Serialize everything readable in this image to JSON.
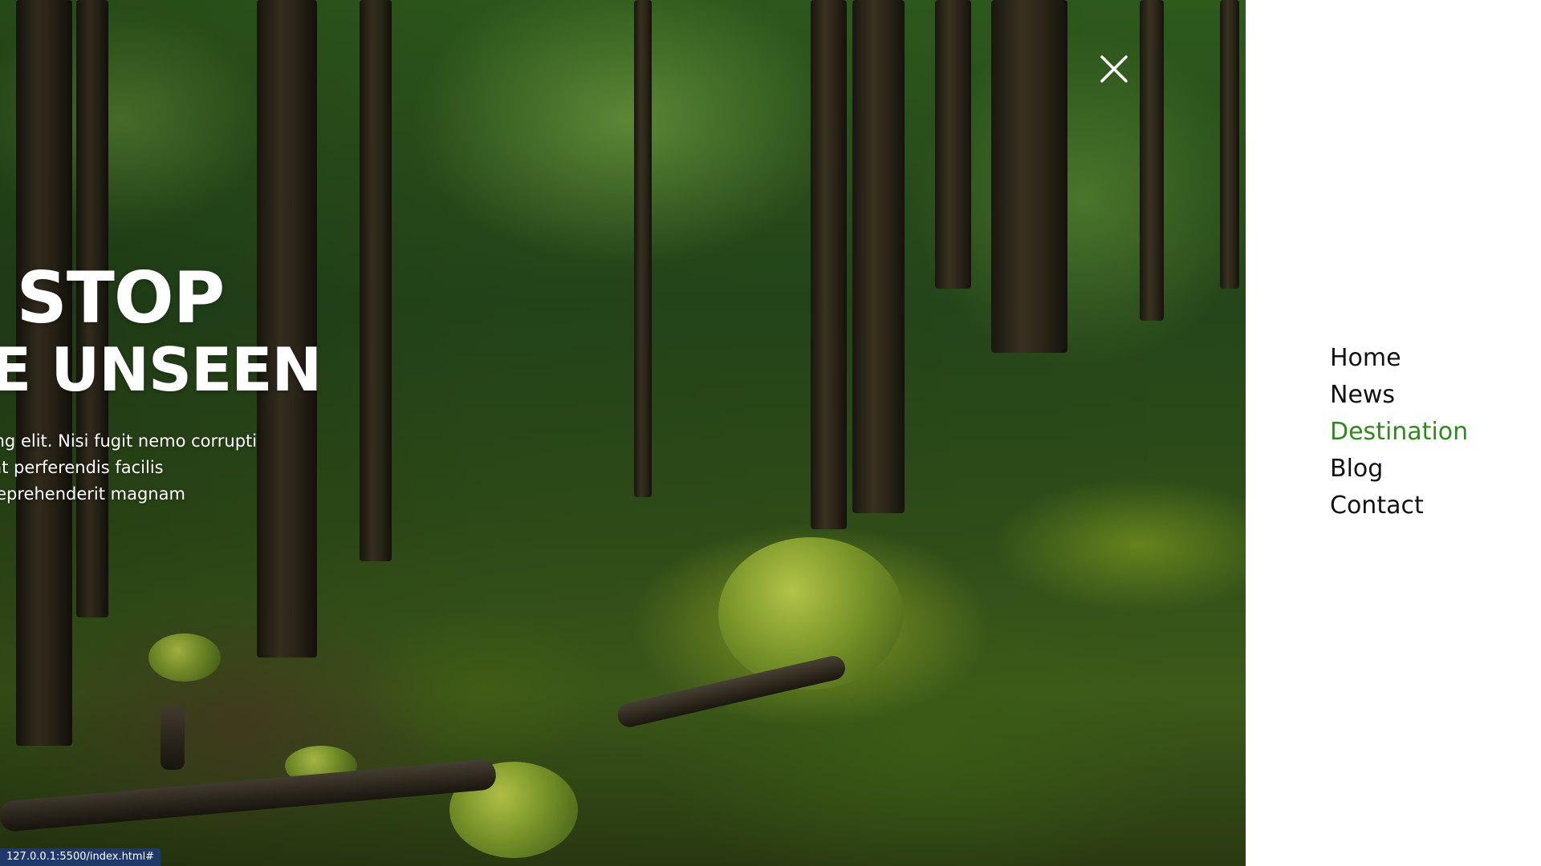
{
  "hero": {
    "title_line1": "ER STOP",
    "title_line2": "RING THE UNSEEN",
    "text_lines": [
      "amet consectetur adipisicing elit. Nisi fugit nemo corrupti",
      "e ipsa error, asperiores sunt perferendis facilis",
      "ssitatibus itaque maxime reprehenderit magnam"
    ]
  },
  "icons": {
    "close": "close-icon"
  },
  "nav": {
    "items": [
      {
        "label": "Home",
        "active": false
      },
      {
        "label": "News",
        "active": false
      },
      {
        "label": "Destination",
        "active": true
      },
      {
        "label": "Blog",
        "active": false
      },
      {
        "label": "Contact",
        "active": false
      }
    ]
  },
  "status_bar": {
    "url": "127.0.0.1:5500/index.html#"
  },
  "colors": {
    "accent": "#2e8b1a",
    "nav_text": "#111111",
    "sidebar_bg": "#ffffff",
    "status_bg": "#1f3a6a"
  }
}
